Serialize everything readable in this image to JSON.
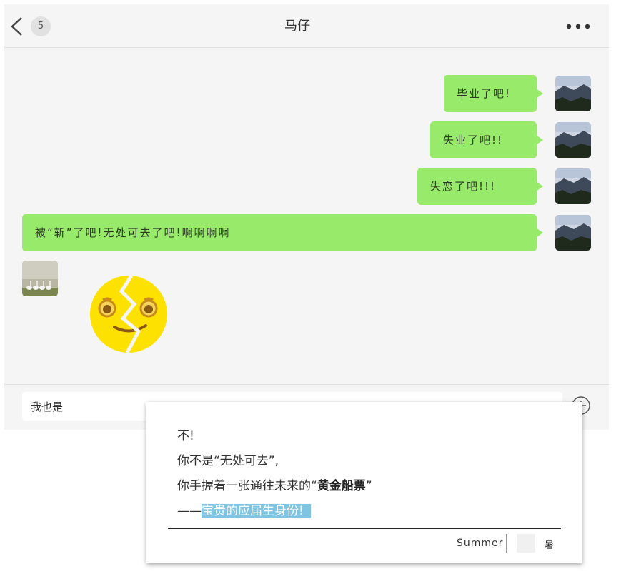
{
  "header": {
    "title": "马仔",
    "badge_count": "5"
  },
  "messages": [
    {
      "side": "right",
      "text": "毕业了吧!"
    },
    {
      "side": "right",
      "text": "失业了吧!!"
    },
    {
      "side": "right",
      "text": "失恋了吧!!!"
    },
    {
      "side": "right",
      "text": "被“斩”了吧!无处可去了吧!啊啊啊啊"
    }
  ],
  "footer": {
    "input_value": "我也是"
  },
  "popup": {
    "line1": "不!",
    "line2": "你不是“无处可去”,",
    "line3_prefix": "你手握着一张通往未来的“",
    "line3_bold": "黄金船票",
    "line3_suffix": "”",
    "line4_dash": "——",
    "line4_highlight": "宝贵的应届生身份!",
    "signature": "Summer",
    "stamp": "暑"
  },
  "colors": {
    "bubble": "#98ea6a",
    "chat_bg": "#f5f5f5",
    "highlight": "#7fc4e3"
  }
}
